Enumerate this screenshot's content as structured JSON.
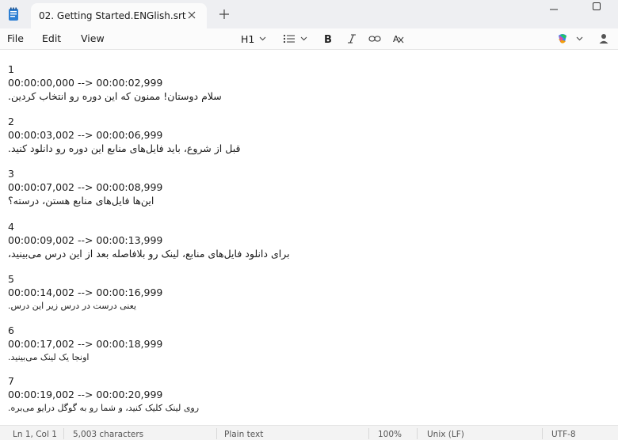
{
  "window": {
    "tab_title": "02. Getting Started.ENGlish.srt"
  },
  "menu": {
    "file": "File",
    "edit": "Edit",
    "view": "View"
  },
  "toolbar": {
    "heading": "H1"
  },
  "subtitles": [
    {
      "index": "1",
      "time": "00:00:00,000 --> 00:00:02,999",
      "text": "سلام دوستان! ممنون که این دوره رو انتخاب کردین."
    },
    {
      "index": "2",
      "time": "00:00:03,002 --> 00:00:06,999",
      "text": "قبل از شروع، باید فایل‌های منابع این دوره رو دانلود کنید."
    },
    {
      "index": "3",
      "time": "00:00:07,002 --> 00:00:08,999",
      "text": "این‌ها فایل‌های منابع هستن، درسته؟"
    },
    {
      "index": "4",
      "time": "00:00:09,002 --> 00:00:13,999",
      "text": "برای دانلود فایل‌های منابع، لینک رو بلافاصله بعد از این درس می‌بینید،"
    },
    {
      "index": "5",
      "time": "00:00:14,002 --> 00:00:16,999",
      "text": "یعنی درست در درس زیر این درس."
    },
    {
      "index": "6",
      "time": "00:00:17,002 --> 00:00:18,999",
      "text": "اونجا یک لینک می‌بینید."
    },
    {
      "index": "7",
      "time": "00:00:19,002 --> 00:00:20,999",
      "text": "روی لینک کلیک کنید، و شما رو به گوگل درایو می‌بره."
    }
  ],
  "status": {
    "position": "Ln 1, Col 1",
    "characters": "5,003 characters",
    "format": "Plain text",
    "zoom": "100%",
    "line_ending": "Unix (LF)",
    "encoding": "UTF-8"
  }
}
